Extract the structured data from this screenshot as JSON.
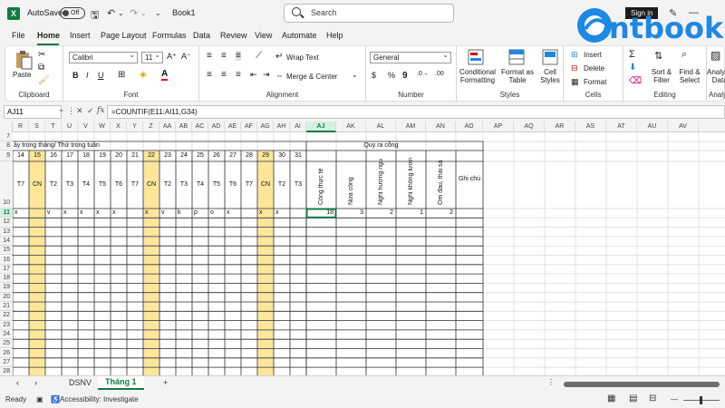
{
  "titlebar": {
    "autosave_label": "AutoSave",
    "autosave_state": "Off",
    "book_name": "Book1",
    "search_placeholder": "Search",
    "signin_label": "Sign in"
  },
  "brand": {
    "text": "ntbook"
  },
  "menu": [
    "File",
    "Home",
    "Insert",
    "Page Layout",
    "Formulas",
    "Data",
    "Review",
    "View",
    "Automate",
    "Help"
  ],
  "ribbon": {
    "clipboard": {
      "paste": "Paste",
      "label": "Clipboard"
    },
    "font": {
      "name": "Calibri",
      "size": "11",
      "label": "Font"
    },
    "alignment": {
      "wrap": "Wrap Text",
      "merge": "Merge & Center",
      "label": "Alignment"
    },
    "number": {
      "format": "General",
      "label": "Number"
    },
    "styles": {
      "cond1": "Conditional",
      "cond2": "Formatting",
      "fmt1": "Format as",
      "fmt2": "Table",
      "cell1": "Cell",
      "cell2": "Styles",
      "label": "Styles"
    },
    "cells": {
      "insert": "Insert",
      "delete": "Delete",
      "format": "Format",
      "label": "Cells"
    },
    "editing": {
      "sort1": "Sort &",
      "sort2": "Filter",
      "find1": "Find &",
      "find2": "Select",
      "label": "Editing"
    },
    "analysis": {
      "l1": "Analyze",
      "l2": "Data",
      "label": "Analys"
    }
  },
  "formula_bar": {
    "name_box": "AJ11",
    "fx": "fx",
    "formula": "=COUNTIF(E11:AI11,G34)"
  },
  "grid": {
    "columns": [
      "R",
      "S",
      "T",
      "U",
      "V",
      "W",
      "X",
      "Y",
      "Z",
      "AA",
      "AB",
      "AC",
      "AD",
      "AE",
      "AF",
      "AG",
      "AH",
      "AI",
      "AJ",
      "AK",
      "AL",
      "AM",
      "AN",
      "AO",
      "AP",
      "AQ",
      "AR",
      "AS",
      "AT",
      "AU",
      "AV"
    ],
    "selected_column": "AJ",
    "rows": [
      "7",
      "8",
      "9",
      "",
      "10",
      "11",
      "12",
      "13",
      "14",
      "15",
      "16",
      "17",
      "18",
      "19",
      "20",
      "21",
      "22",
      "23",
      "24",
      "25",
      "26",
      "27",
      "28"
    ],
    "selected_row": "11",
    "header_day_month": "ày trong tháng/ Thứ trong tuần",
    "header_quy_ra_cong": "Quy ra công",
    "days": [
      "14",
      "15",
      "16",
      "17",
      "18",
      "19",
      "20",
      "21",
      "22",
      "23",
      "24",
      "25",
      "26",
      "27",
      "28",
      "29",
      "30",
      "31"
    ],
    "weekdays": [
      "T7",
      "CN",
      "T2",
      "T3",
      "T4",
      "T5",
      "T6",
      "T7",
      "CN",
      "T2",
      "T3",
      "T4",
      "T5",
      "T6",
      "T7",
      "CN",
      "T2",
      "T3"
    ],
    "summary_headers": [
      "Công thực tế",
      "Nửa công",
      "Nghỉ hưởng ngu",
      "Nghỉ không lươn",
      "Ốm đau, thai sả"
    ],
    "note_header": "Ghi chú",
    "row11_marks": [
      "x",
      "",
      "v",
      "x",
      "x",
      "x",
      "x",
      "",
      "x",
      "v",
      "k",
      "p",
      "o",
      "x",
      "",
      "x",
      "x"
    ],
    "row11_values": [
      "18",
      "3",
      "2",
      "1",
      "2"
    ]
  },
  "sheets": {
    "tabs": [
      "DSNV",
      "Tháng 1"
    ],
    "active": "Tháng 1",
    "add": "+"
  },
  "status": {
    "ready": "Ready",
    "accessibility": "Accessibility: Investigate"
  },
  "colors": {
    "accent": "#107c41",
    "highlight": "#ffe699",
    "brand": "#1e88e5"
  }
}
